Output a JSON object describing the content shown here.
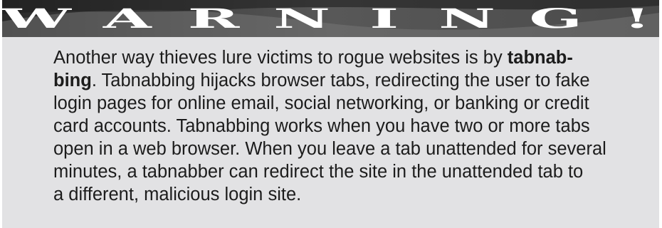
{
  "header": {
    "title": "WARNING!",
    "letters": [
      "W",
      "A",
      "R",
      "N",
      "I",
      "N",
      "G",
      "!"
    ]
  },
  "body": {
    "lines": [
      {
        "text": "Another way thieves lure victims to rogue websites is by ",
        "bold": "tabnab-"
      },
      {
        "bold": "bing",
        "text": ". Tabnabbing hijacks browser tabs, redirecting the user to fake"
      },
      {
        "text": "login pages for online email, social networking, or banking or credit"
      },
      {
        "text": "card accounts. Tabnabbing works when you have two or more tabs"
      },
      {
        "text": "open in a web browser. When you leave a tab unattended for several"
      },
      {
        "text": "minutes, a tabnabber can redirect the site in the unattended tab to"
      },
      {
        "text": "a different, malicious login site."
      }
    ]
  },
  "colors": {
    "box_background": "#e2e2e4",
    "header_background": "#3c3c3c",
    "header_text": "#ffffff",
    "body_text": "#1c1c1c"
  }
}
